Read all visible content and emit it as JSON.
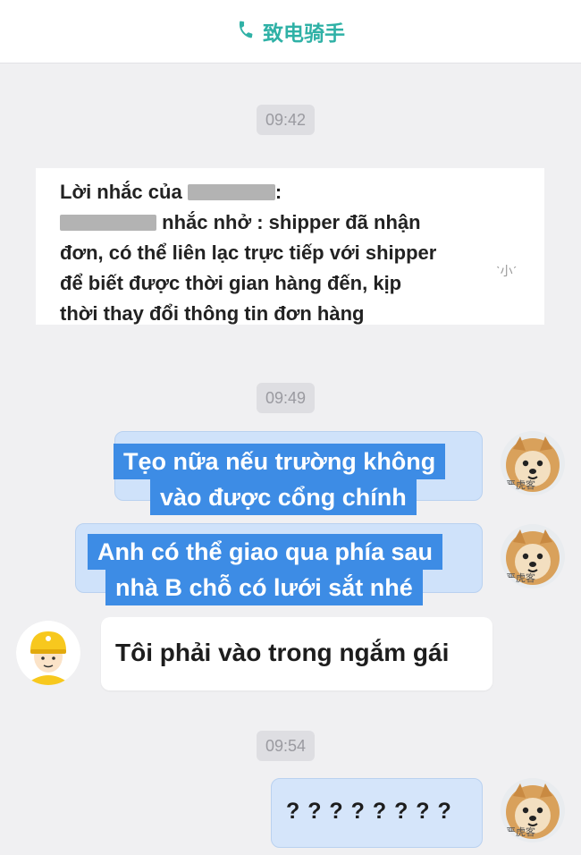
{
  "header": {
    "call_label": "致电骑手",
    "phone_icon": "phone-icon"
  },
  "timestamps": [
    "09:42",
    "09:49",
    "09:54"
  ],
  "system_notice": {
    "line1_prefix": "Lời nhắc của",
    "line1_suffix": ":",
    "line2_suffix": "nhắc nhở : shipper đã nhận",
    "line3": "đơn, có thể liên lạc trực tiếp với shipper",
    "line4": "để biết được thời gian hàng đến, kịp",
    "line5": "thời thay đổi thông tin đơn hàng",
    "deco": "ˋ小ˊ"
  },
  "messages": [
    {
      "sender": "me",
      "lines": [
        "Tẹo nữa nếu trường không",
        "vào được cổng chính"
      ]
    },
    {
      "sender": "me",
      "lines": [
        "Anh có thể giao qua phía sau",
        "nhà B chỗ có lưới sắt nhé"
      ]
    },
    {
      "sender": "rider",
      "text": "Tôi phải vào trong ngắm gái"
    },
    {
      "sender": "me",
      "text": "? ? ? ? ? ? ? ?"
    }
  ],
  "avatars": {
    "me_caption": "严虎客",
    "me_icon": "pomeranian-dog-avatar",
    "rider_icon": "rider-helmet-avatar"
  },
  "colors": {
    "accent": "#2fb1a6",
    "highlight": "#3d8ce5",
    "bubble_me": "#cfe2fa"
  }
}
